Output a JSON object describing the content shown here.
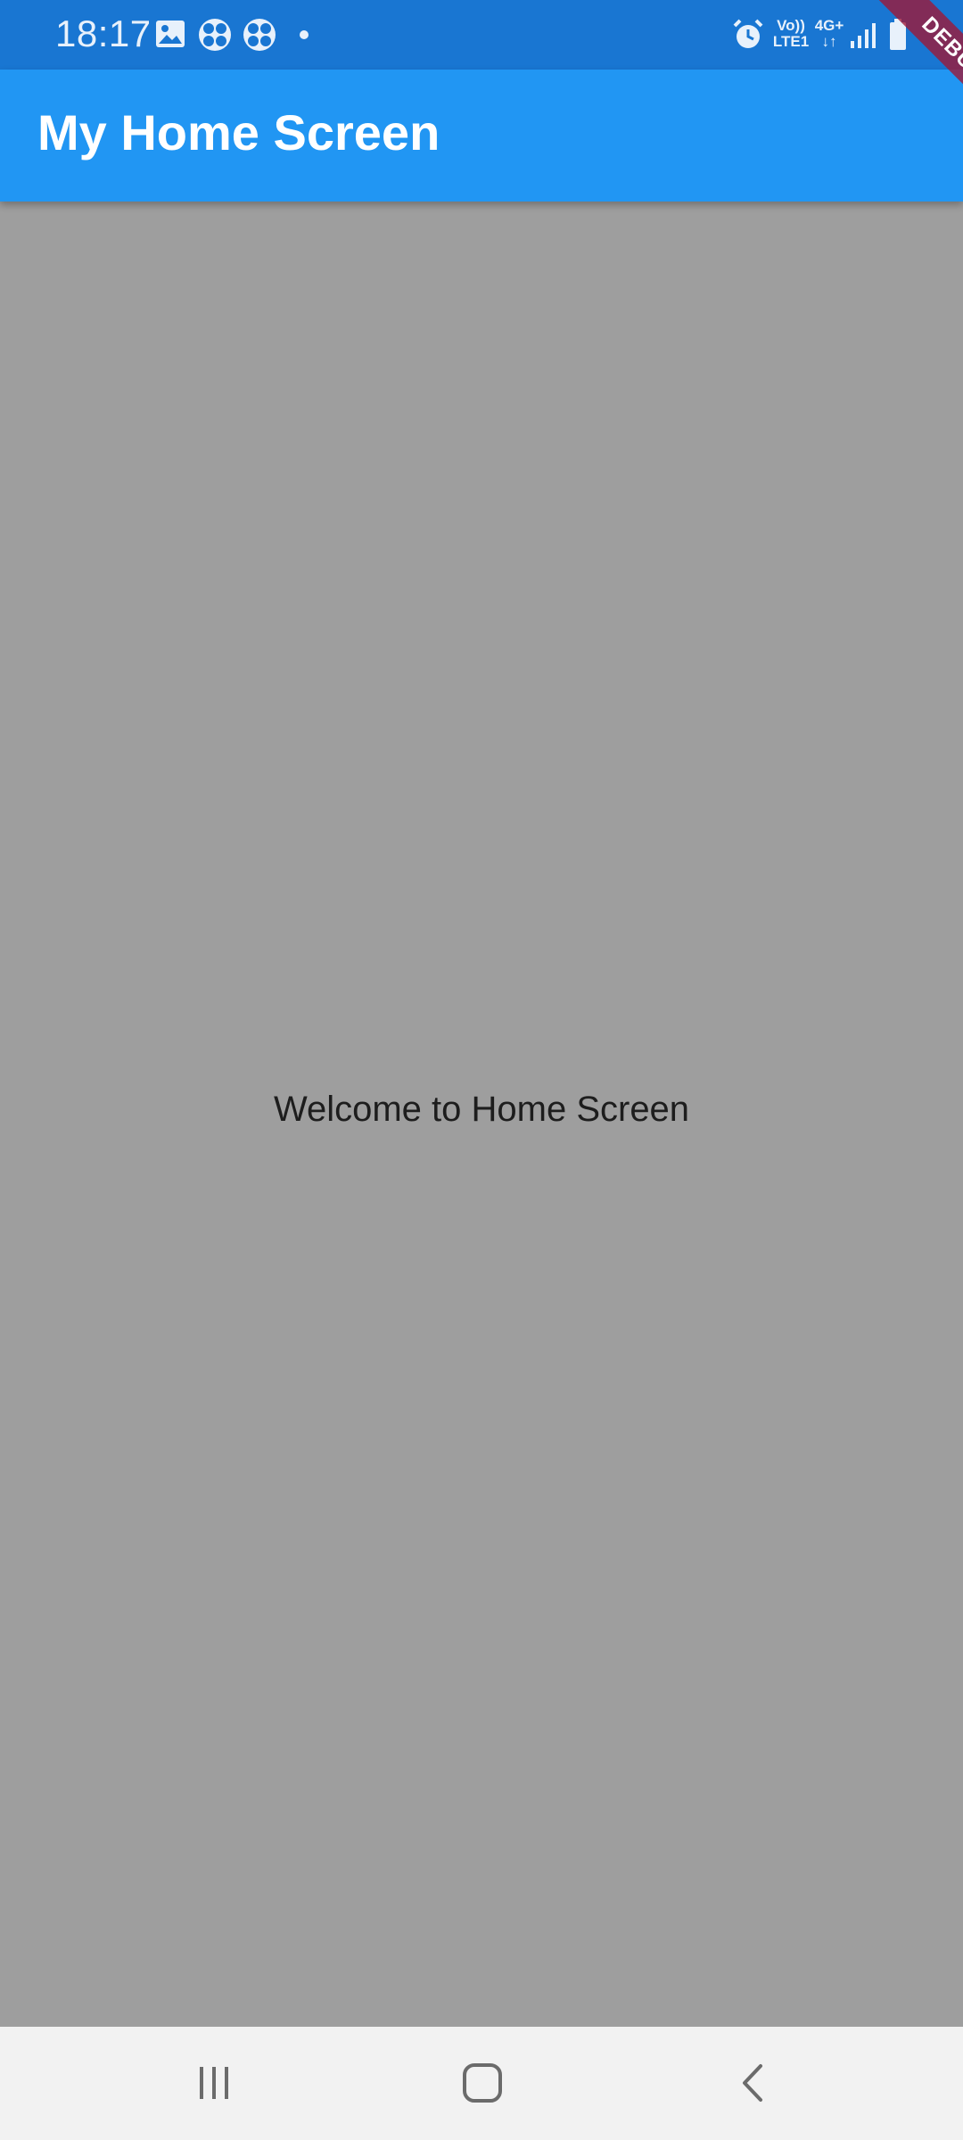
{
  "status_bar": {
    "time": "18:17",
    "left_icons": [
      "image-icon",
      "pinwheel-icon",
      "pinwheel-icon",
      "notification-dot-icon"
    ],
    "network_label_1_top": "Vo))",
    "network_label_1_bottom": "LTE1",
    "network_label_2_top": "4G+",
    "network_label_2_bottom": "↓↑",
    "right_icons": [
      "alarm-icon",
      "volte-icon",
      "data-icon",
      "signal-icon",
      "battery-icon"
    ]
  },
  "app_bar": {
    "title": "My Home Screen",
    "color": "#2196f3"
  },
  "body": {
    "welcome_text": "Welcome to Home Screen",
    "background": "#9e9e9e"
  },
  "debug_banner": {
    "label": "DEBUG"
  },
  "nav_bar": {
    "buttons": [
      "recent-apps-icon",
      "home-icon",
      "back-icon"
    ]
  }
}
